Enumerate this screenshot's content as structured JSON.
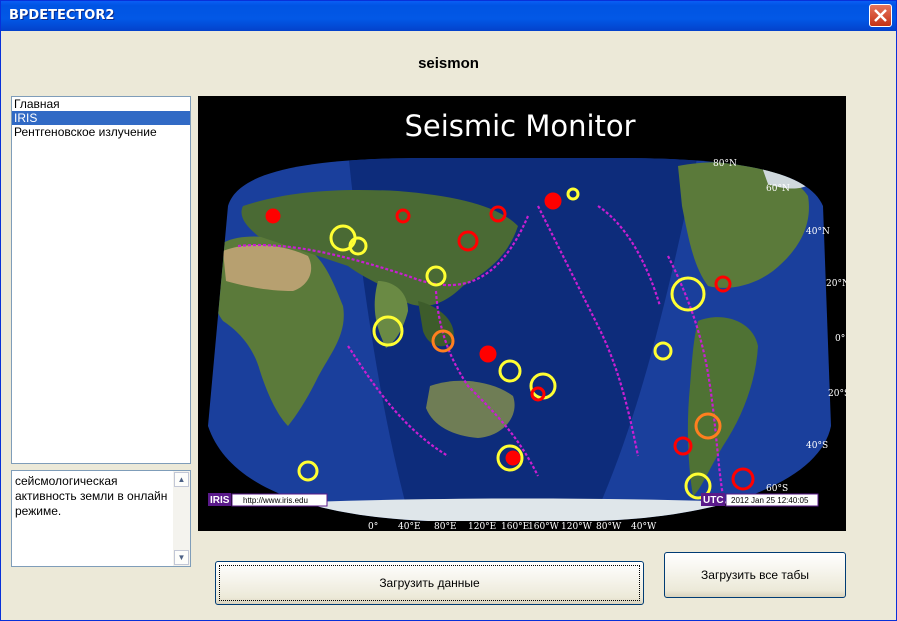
{
  "window": {
    "title": "BPDETECTOR2",
    "heading": "seismon"
  },
  "list": {
    "items": [
      {
        "label": "Главная"
      },
      {
        "label": "IRIS",
        "selected": true
      },
      {
        "label": "Рентгеновское излучение"
      }
    ]
  },
  "description": {
    "text": "сейсмологическая активность земли в онлайн режиме."
  },
  "monitor": {
    "title": "Seismic Monitor",
    "source_label": "IRIS",
    "url": "http://www.iris.edu",
    "utc_label": "UTC",
    "timestamp": "2012 Jan 25 12:40:05",
    "lat_labels": [
      "80°N",
      "60°N",
      "40°N",
      "20°N",
      "0°",
      "20°S",
      "40°S",
      "60°S"
    ],
    "lon_labels": [
      "0°",
      "40°E",
      "80°E",
      "120°E",
      "160°E",
      "160°W",
      "120°W",
      "80°W",
      "40°W"
    ],
    "colors": {
      "ocean": "#1a3f9c",
      "night_ocean": "#0c2a78",
      "land": "#5b7a3a",
      "plate_boundary": "#c81fd2",
      "quake_recent": "#ff0000",
      "quake_day": "#ff7f1f",
      "quake_week": "#ffff33"
    }
  },
  "buttons": {
    "load_data": "Загрузить данные",
    "load_all_tabs": "Загрузить все табы"
  }
}
